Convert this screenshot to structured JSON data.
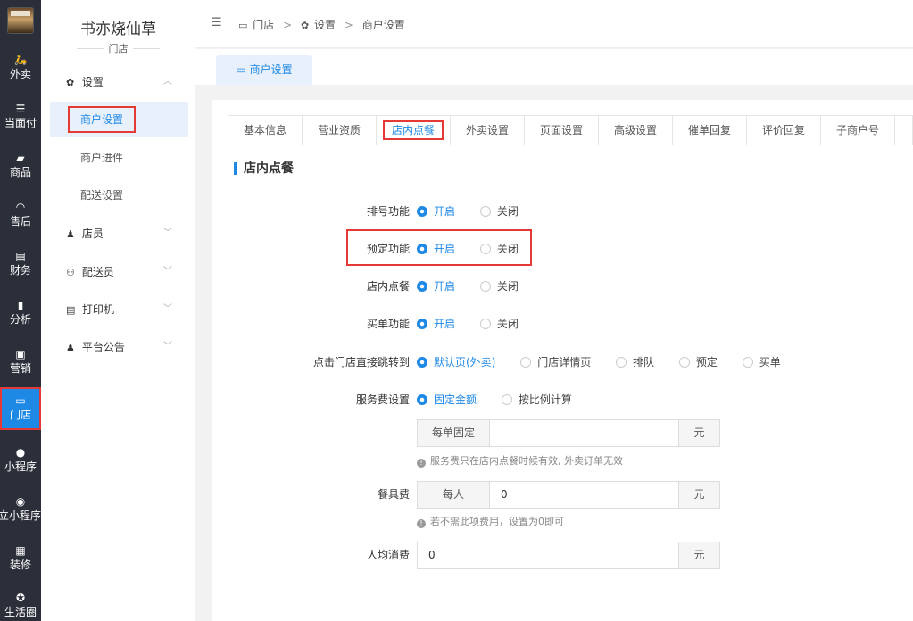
{
  "rail": {
    "items": [
      {
        "label": "外卖",
        "icon": "🛵"
      },
      {
        "label": "当面付",
        "icon": "☰"
      },
      {
        "label": "商品",
        "icon": "▰"
      },
      {
        "label": "售后",
        "icon": "◠"
      },
      {
        "label": "财务",
        "icon": "▤"
      },
      {
        "label": "分析",
        "icon": "▮"
      },
      {
        "label": "营销",
        "icon": "▣"
      },
      {
        "label": "门店",
        "icon": "▭"
      },
      {
        "label": "小程序",
        "icon": "●"
      },
      {
        "label": "独立小程序",
        "icon": "◉"
      },
      {
        "label": "装修",
        "icon": "▦"
      },
      {
        "label": "生活圈",
        "icon": "✪"
      }
    ]
  },
  "sidebar": {
    "store_name": "书亦烧仙草",
    "store_sub": "门店",
    "groups": {
      "settings": "设置",
      "staff": "店员",
      "courier": "配送员",
      "printer": "打印机",
      "notice": "平台公告"
    },
    "subs": {
      "merchant_settings": "商户设置",
      "merchant_entry": "商户进件",
      "delivery_settings": "配送设置"
    }
  },
  "breadcrumb": {
    "store": "门店",
    "settings": "设置",
    "current": "商户设置"
  },
  "page_tab": "商户设置",
  "tabs": [
    "基本信息",
    "营业资质",
    "店内点餐",
    "外卖设置",
    "页面设置",
    "高级设置",
    "催单回复",
    "评价回复",
    "子商户号"
  ],
  "section_title": "店内点餐",
  "form": {
    "queue": {
      "label": "排号功能",
      "on": "开启",
      "off": "关闭",
      "selected": "on"
    },
    "reserve": {
      "label": "预定功能",
      "on": "开启",
      "off": "关闭",
      "selected": "on"
    },
    "dine_in": {
      "label": "店内点餐",
      "on": "开启",
      "off": "关闭",
      "selected": "on"
    },
    "checkout": {
      "label": "买单功能",
      "on": "开启",
      "off": "关闭",
      "selected": "on"
    },
    "jump": {
      "label": "点击门店直接跳转到",
      "options": [
        "默认页(外卖)",
        "门店详情页",
        "排队",
        "预定",
        "买单"
      ],
      "selected": 0
    },
    "service_fee": {
      "label": "服务费设置",
      "options": [
        "固定金额",
        "按比例计算"
      ],
      "selected": 0,
      "prefix": "每单固定",
      "value": "",
      "suffix": "元",
      "hint": "服务费只在店内点餐时候有效, 外卖订单无效"
    },
    "tableware": {
      "label": "餐具费",
      "prefix": "每人",
      "value": "0",
      "suffix": "元",
      "hint": "若不需此项费用，设置为0即可"
    },
    "avg_spend": {
      "label": "人均消费",
      "value": "0",
      "suffix": "元"
    }
  },
  "colors": {
    "accent": "#1e88e5",
    "highlight": "#e53935",
    "rail_bg": "#2b2f3a"
  }
}
